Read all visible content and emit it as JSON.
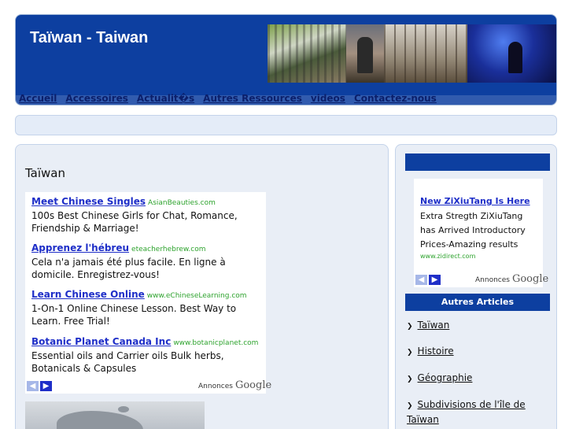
{
  "site": {
    "title": "Taïwan - Taiwan"
  },
  "nav": {
    "items": [
      "Accueil",
      "Accessoires",
      "Actualit�s",
      "Autres Ressources",
      "videos",
      "Contactez-nous"
    ]
  },
  "main": {
    "title": "Taïwan",
    "ads": [
      {
        "title": "Meet Chinese Singles",
        "url": "AsianBeauties.com",
        "desc": "100s Best Chinese Girls for Chat, Romance, Friendship & Marriage!"
      },
      {
        "title": "Apprenez l'hébreu",
        "url": "eteacherhebrew.com",
        "desc": "Cela n'a jamais été plus facile. En ligne à domicile. Enregistrez-vous!"
      },
      {
        "title": "Learn Chinese Online",
        "url": "www.eChineseLearning.com",
        "desc": "1-On-1 Online Chinese Lesson. Best Way to Learn. Free Trial!"
      },
      {
        "title": "Botanic Planet Canada Inc",
        "url": "www.botanicplanet.com",
        "desc": "Essential oils and Carrier oils Bulk herbs, Botanicals & Capsules"
      }
    ],
    "ad_choices": "Annonces",
    "ad_brand": "Google"
  },
  "sidebar": {
    "ad": {
      "title": "New ZiXiuTang Is Here",
      "desc": "Extra Stregth ZiXiuTang has Arrived Introductory Prices-Amazing results",
      "url": "www.zidirect.com"
    },
    "ad_choices": "Annonces",
    "ad_brand": "Google",
    "articles_heading": "Autres Articles",
    "articles": [
      "Taïwan",
      "Histoire",
      "Géographie",
      "Subdivisions de l'île de Taïwan"
    ]
  },
  "icons": {
    "prev": "chevron-left-icon",
    "next": "chevron-right-icon",
    "bullet": "chevron-right-icon"
  },
  "colors": {
    "header_blue": "#0d3fa0",
    "link_blue": "#1f2fc8",
    "ad_url_green": "#2ea32e",
    "panel_bg": "#e9eef6"
  }
}
